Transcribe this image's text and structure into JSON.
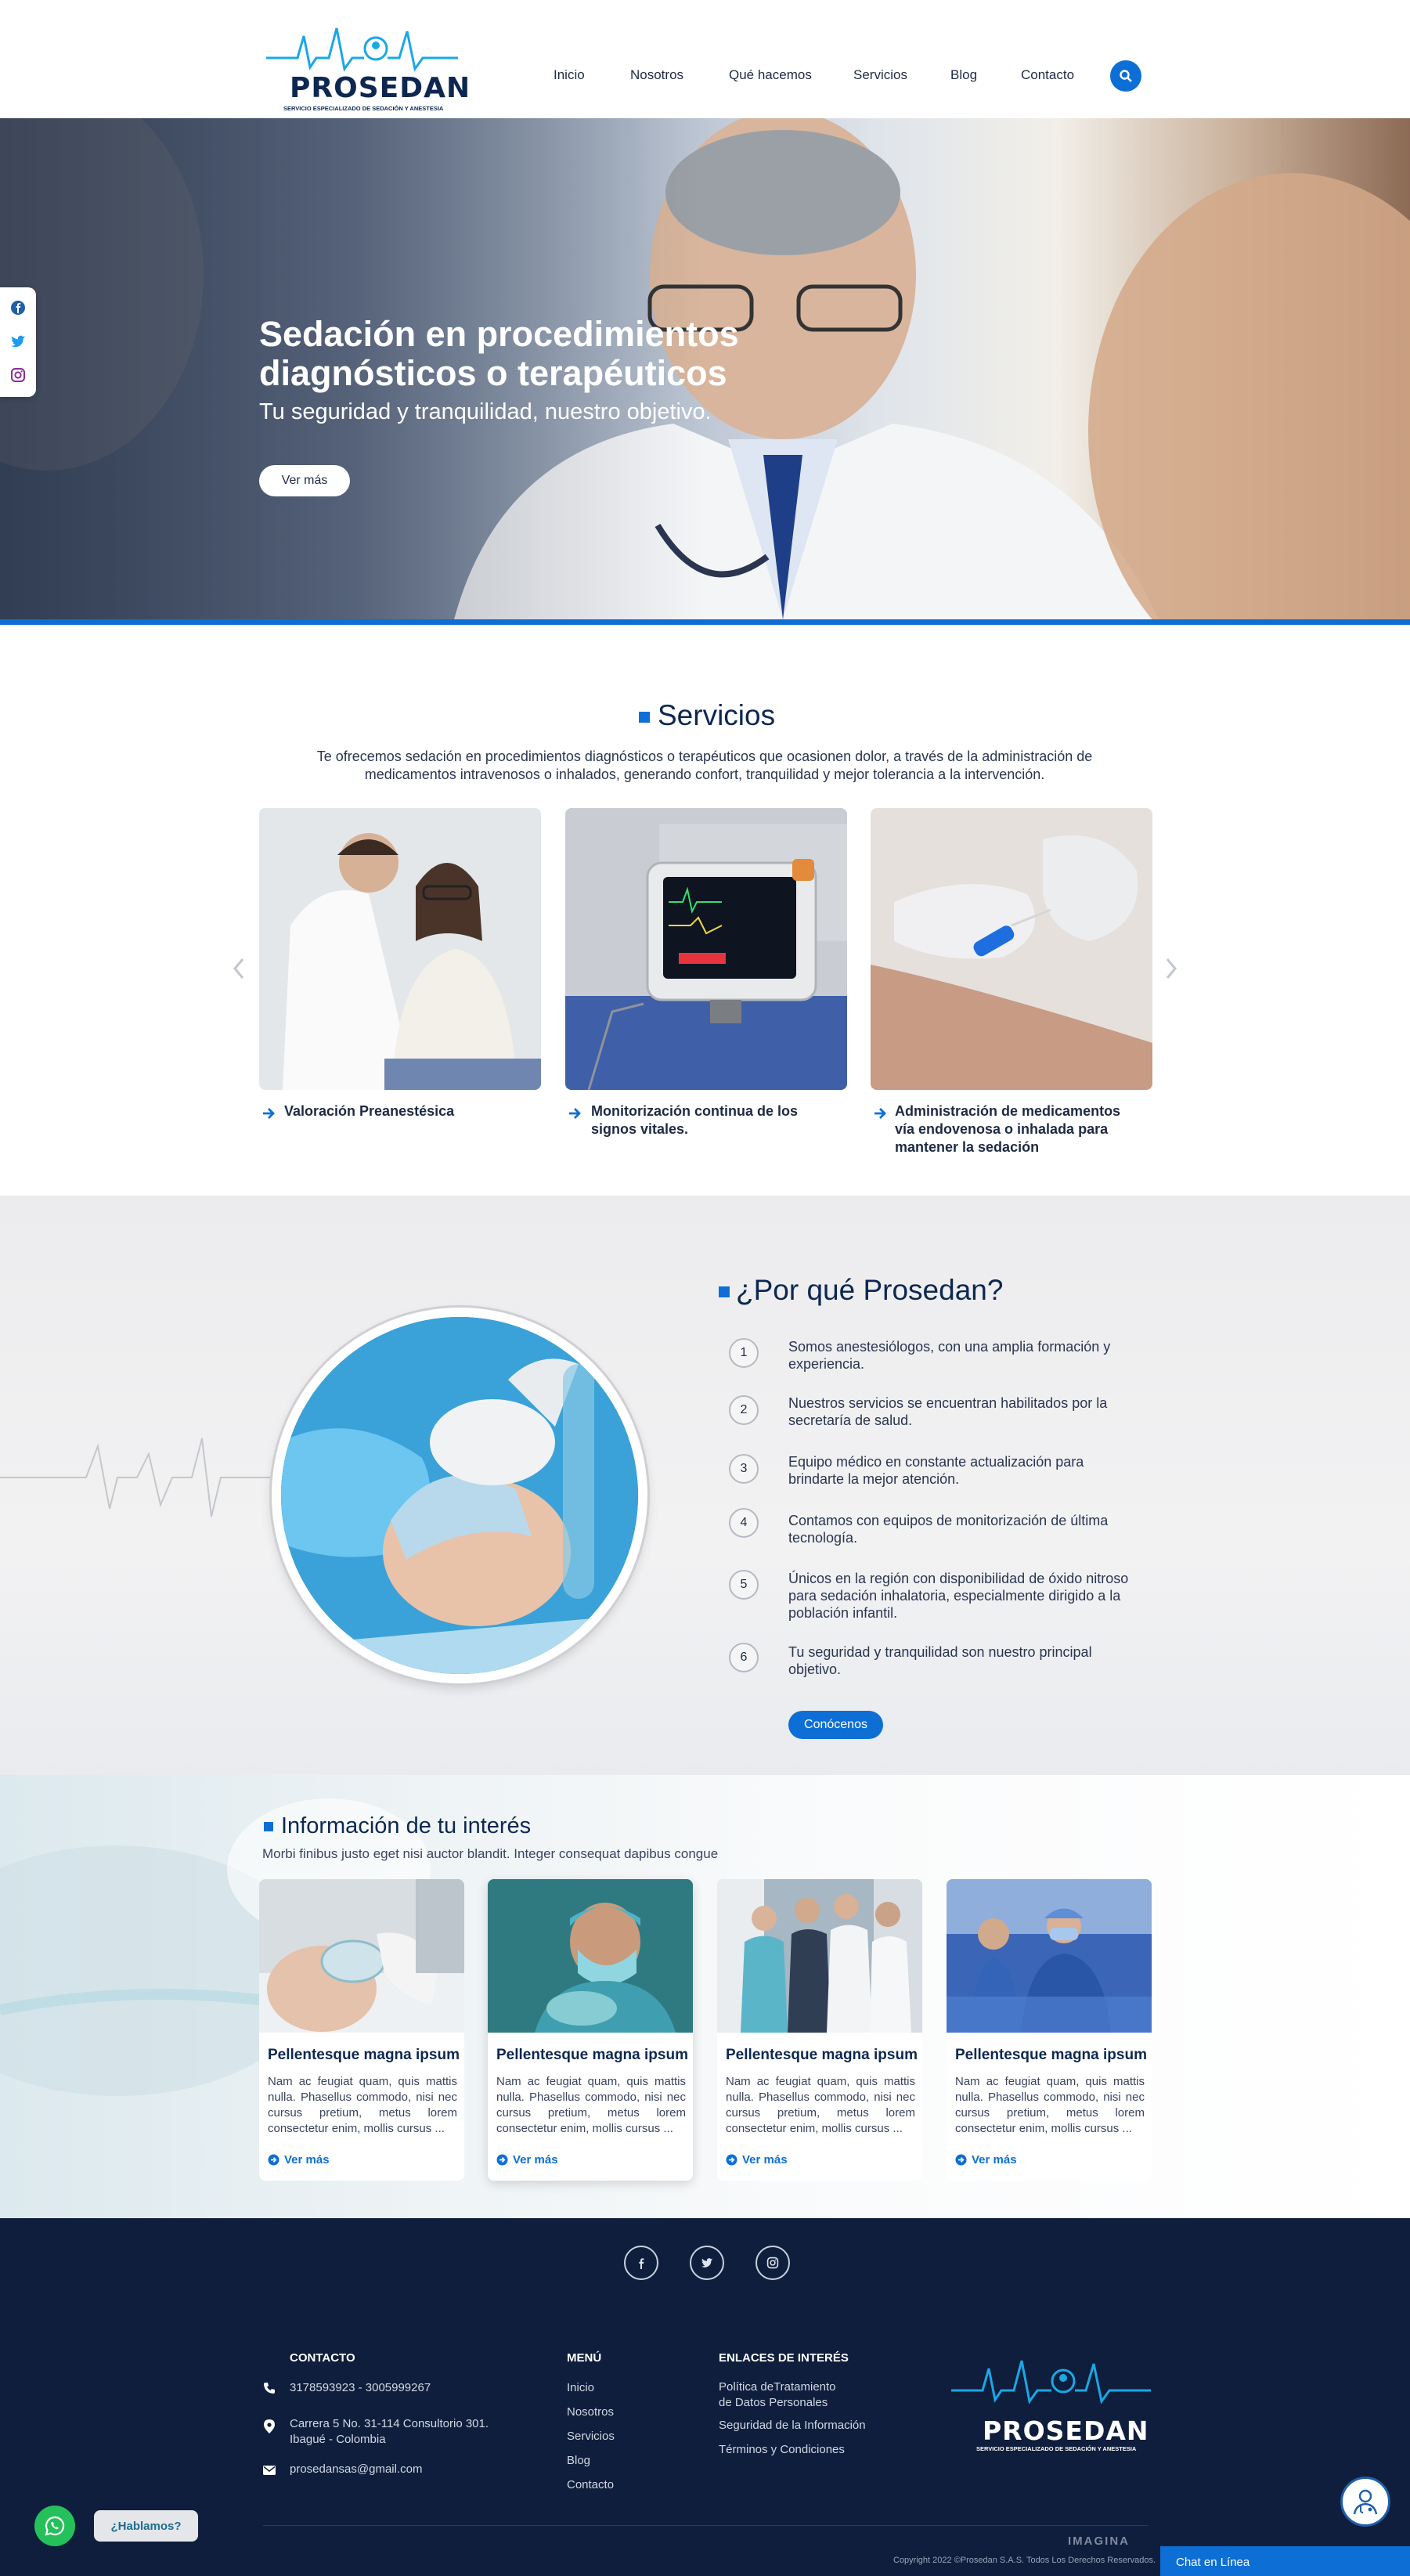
{
  "header": {
    "logo_title": "PROSEDAN",
    "logo_subtitle": "SERVICIO ESPECIALIZADO DE SEDACIÓN Y ANESTESIA",
    "nav": [
      "Inicio",
      "Nosotros",
      "Qué hacemos",
      "Servicios",
      "Blog",
      "Contacto"
    ]
  },
  "hero": {
    "title": "Sedación en procedimientos diagnósticos o terapéuticos",
    "subtitle": "Tu seguridad y tranquilidad, nuestro objetivo.",
    "button": "Ver más"
  },
  "services": {
    "title": "Servicios",
    "description": "Te ofrecemos sedación en procedimientos diagnósticos o terapéuticos que ocasionen dolor, a través de la administración de medicamentos intravenosos o inhalados, generando confort, tranquilidad y mejor tolerancia a la intervención.",
    "items": [
      {
        "label": "Valoración Preanestésica"
      },
      {
        "label": "Monitorización continua de los signos vitales."
      },
      {
        "label": "Administración de medicamentos vía endovenosa o inhalada para mantener la sedación"
      }
    ]
  },
  "why": {
    "title": "¿Por qué Prosedan?",
    "items": [
      {
        "num": "1",
        "text": "Somos anestesiólogos, con una amplia formación y experiencia."
      },
      {
        "num": "2",
        "text": "Nuestros servicios se encuentran habilitados por la secretaría de salud."
      },
      {
        "num": "3",
        "text": "Equipo médico en constante actualización para brindarte la mejor atención."
      },
      {
        "num": "4",
        "text": "Contamos con equipos de monitorización de última tecnología."
      },
      {
        "num": "5",
        "text": "Únicos en la región con disponibilidad de óxido nitroso para sedación inhalatoria, especialmente dirigido a la población infantil."
      },
      {
        "num": "6",
        "text": "Tu seguridad y tranquilidad son nuestro principal objetivo."
      }
    ],
    "button": "Conócenos"
  },
  "info": {
    "title": "Información de tu interés",
    "subtitle": "Morbi finibus justo eget nisi auctor blandit. Integer consequat dapibus congue",
    "cards": [
      {
        "title": "Pellentesque magna ipsum",
        "text": "Nam ac feugiat quam, quis mattis nulla. Phasellus commodo, nisi nec cursus pretium, metus lorem consectetur enim, mollis cursus ...",
        "more": "Ver más"
      },
      {
        "title": "Pellentesque magna ipsum",
        "text": "Nam ac feugiat quam, quis mattis nulla. Phasellus commodo, nisi nec cursus pretium, metus lorem consectetur enim, mollis cursus ...",
        "more": "Ver más"
      },
      {
        "title": "Pellentesque magna ipsum",
        "text": "Nam ac feugiat quam, quis mattis nulla. Phasellus commodo, nisi nec cursus pretium, metus lorem consectetur enim, mollis cursus ...",
        "more": "Ver más"
      },
      {
        "title": "Pellentesque magna ipsum",
        "text": "Nam ac feugiat quam, quis mattis nulla. Phasellus commodo, nisi nec cursus pretium, metus lorem consectetur enim, mollis cursus ...",
        "more": "Ver más"
      }
    ]
  },
  "footer": {
    "contact_title": "CONTACTO",
    "phone": "3178593923 - 3005999267",
    "address_line1": "Carrera 5 No. 31-114 Consultorio 301.",
    "address_line2": "Ibagué - Colombia",
    "email": "prosedansas@gmail.com",
    "menu_title": "MENÚ",
    "menu": [
      "Inicio",
      "Nosotros",
      "Servicios",
      "Blog",
      "Contacto"
    ],
    "links_title": "ENLACES DE INTERÉS",
    "links": [
      "Política deTratamiento",
      "de Datos Personales",
      "Seguridad de la Información",
      "Términos y Condiciones"
    ],
    "logo_title": "PROSEDAN",
    "logo_subtitle": "SERVICIO ESPECIALIZADO DE SEDACIÓN Y ANESTESIA",
    "agency": "IMAGINA",
    "copyright": "Copyright 2022 ©Prosedan S.A.S. Todos Los Derechos Reservados."
  },
  "widgets": {
    "whatsapp_label": "¿Hablamos?",
    "chat_label": "Chat en Línea"
  },
  "colors": {
    "accent": "#0d6fd6",
    "navy": "#0d2850",
    "footer_bg": "#0f1e3c",
    "whatsapp": "#25c05a"
  }
}
